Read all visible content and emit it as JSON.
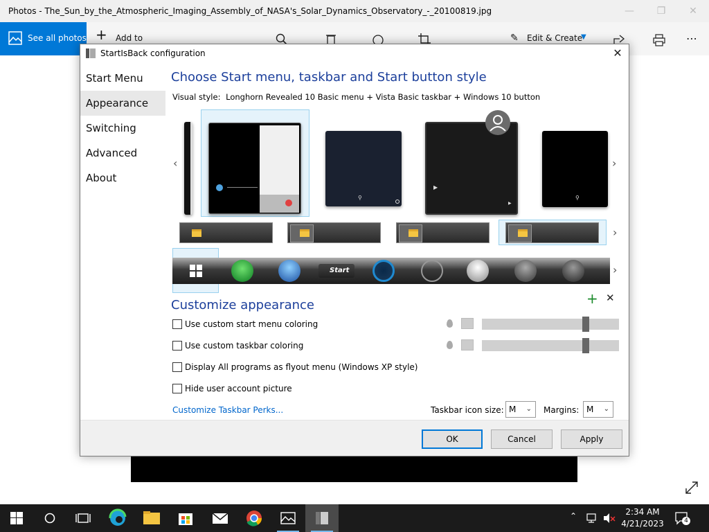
{
  "photos": {
    "title": "Photos - The_Sun_by_the_Atmospheric_Imaging_Assembly_of_NASA's_Solar_Dynamics_Observatory_-_20100819.jpg",
    "see_all": "See all photos",
    "add_to": "Add to",
    "edit_create": "Edit & Create"
  },
  "dialog": {
    "title": "StartIsBack configuration",
    "nav": [
      "Start Menu",
      "Appearance",
      "Switching",
      "Advanced",
      "About"
    ],
    "active_nav": "Appearance",
    "heading": "Choose Start menu, taskbar and Start button style",
    "visual_style_label": "Visual style:",
    "visual_style_value": "Longhorn Revealed 10 Basic menu + Vista Basic taskbar + Windows 10 button",
    "customize_heading": "Customize appearance",
    "options": [
      {
        "label": "Use custom start menu coloring",
        "checked": false
      },
      {
        "label": "Use custom taskbar coloring",
        "checked": false
      },
      {
        "label": "Display All programs as flyout menu (Windows XP style)",
        "checked": false
      },
      {
        "label": "Hide user account picture",
        "checked": false
      }
    ],
    "perks_link": "Customize Taskbar Perks...",
    "icon_size_label": "Taskbar icon size:",
    "icon_size_value": "M",
    "margins_label": "Margins:",
    "margins_value": "M",
    "start_label": "Start",
    "buttons": {
      "ok": "OK",
      "cancel": "Cancel",
      "apply": "Apply"
    }
  },
  "taskbar": {
    "time": "2:34 AM",
    "date": "4/21/2023",
    "notification_count": "4"
  },
  "colors": {
    "accent": "#0078d7",
    "heading": "#1c3f9b",
    "link": "#0066cc",
    "taskbar": "#1b1b1b"
  }
}
